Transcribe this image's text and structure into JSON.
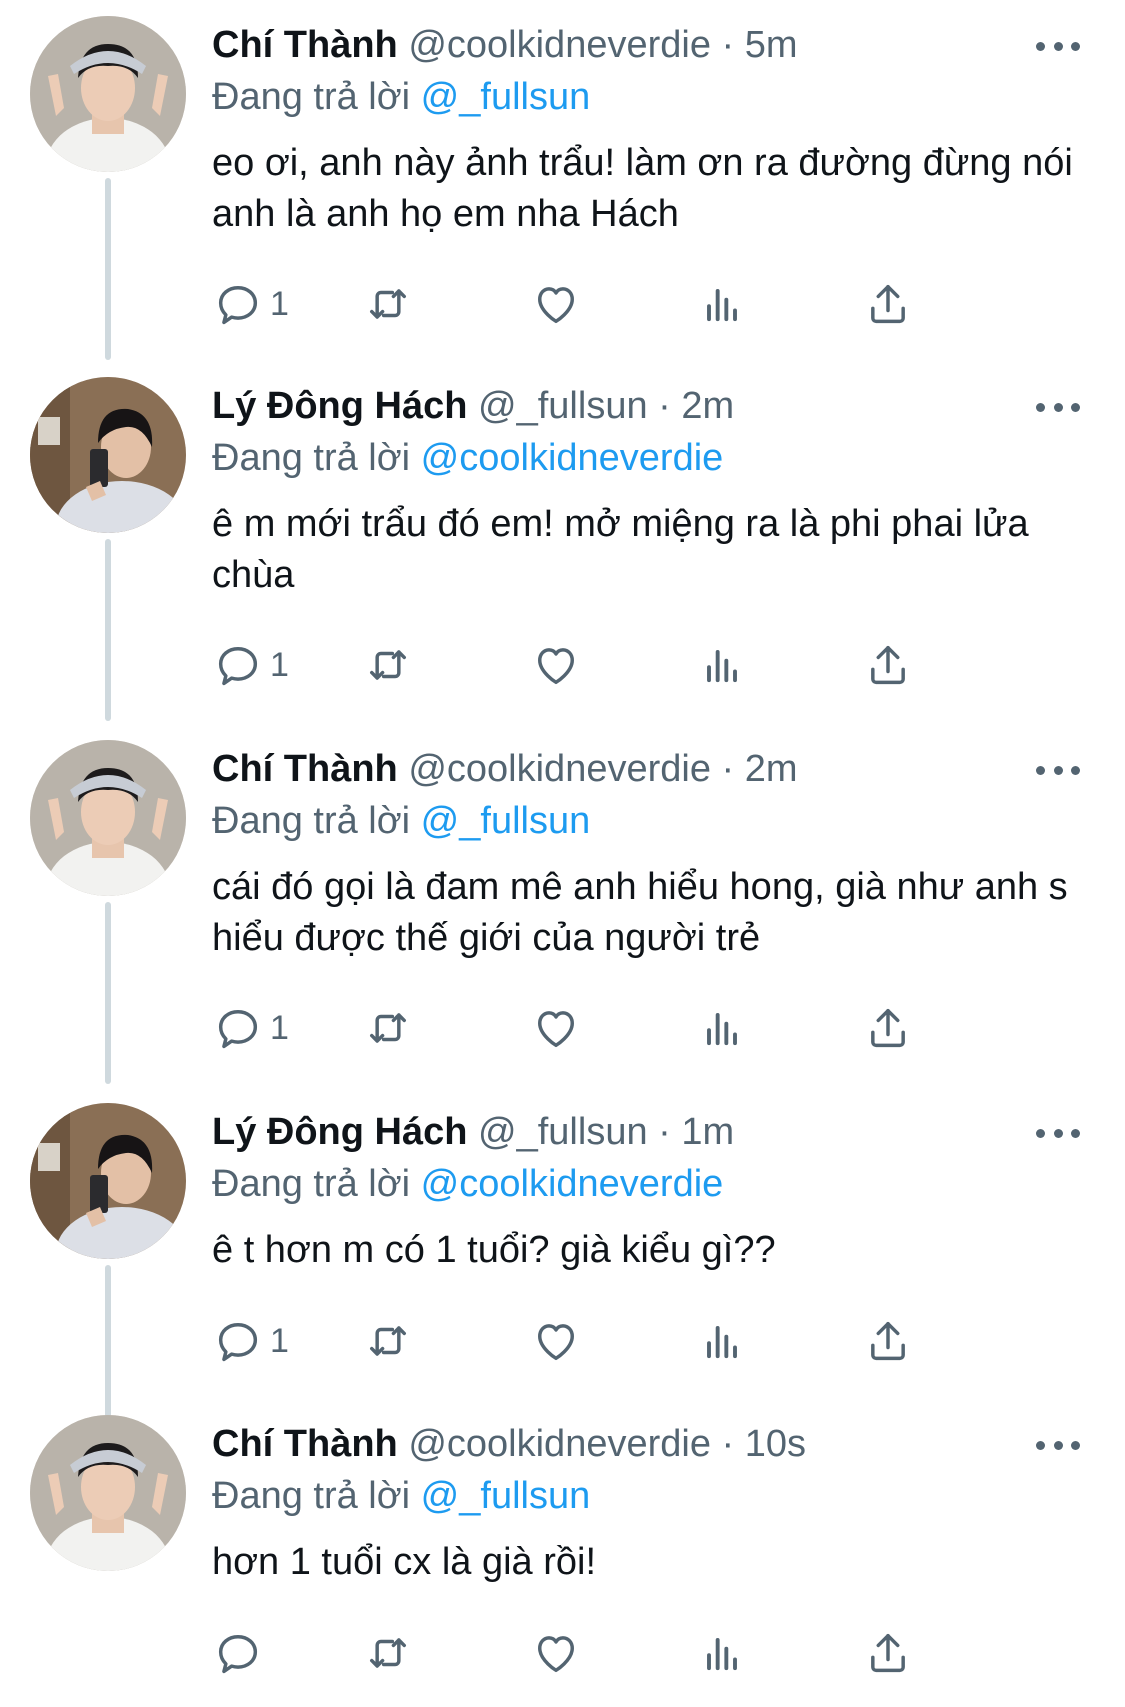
{
  "tweets": [
    {
      "name": "Chí Thành",
      "handle": "@coolkidneverdie",
      "time": "5m",
      "reply_prefix": "Đang trả lời",
      "reply_to": "@_fullsun",
      "text": "eo ơi, anh này ảnh trẩu! làm ơn ra đường đừng nói anh là anh họ em nha Hách",
      "reply_count": "1"
    },
    {
      "name": "Lý Đông Hách",
      "handle": "@_fullsun",
      "time": "2m",
      "reply_prefix": "Đang trả lời",
      "reply_to": "@coolkidneverdie",
      "text": "ê m mới trẩu đó em! mở miệng ra là phi phai lửa chùa",
      "reply_count": "1"
    },
    {
      "name": "Chí Thành",
      "handle": "@coolkidneverdie",
      "time": "2m",
      "reply_prefix": "Đang trả lời",
      "reply_to": "@_fullsun",
      "text": "cái đó gọi là đam mê anh hiểu hong, già như anh s hiểu được thế giới của người trẻ",
      "reply_count": "1"
    },
    {
      "name": "Lý Đông Hách",
      "handle": "@_fullsun",
      "time": "1m",
      "reply_prefix": "Đang trả lời",
      "reply_to": "@coolkidneverdie",
      "text": "ê t hơn m có 1 tuổi? già kiểu gì??",
      "reply_count": "1"
    },
    {
      "name": "Chí Thành",
      "handle": "@coolkidneverdie",
      "time": "10s",
      "reply_prefix": "Đang trả lời",
      "reply_to": "@_fullsun",
      "text": "hơn 1 tuổi cx là già rồi!",
      "reply_count": ""
    }
  ],
  "separator": "·",
  "colors": {
    "accent": "#1d9bf0",
    "secondary_text": "#536471",
    "thread_line": "#cfd9de"
  },
  "icons": [
    "reply-icon",
    "retweet-icon",
    "like-icon",
    "analytics-icon",
    "share-icon",
    "more-icon"
  ]
}
